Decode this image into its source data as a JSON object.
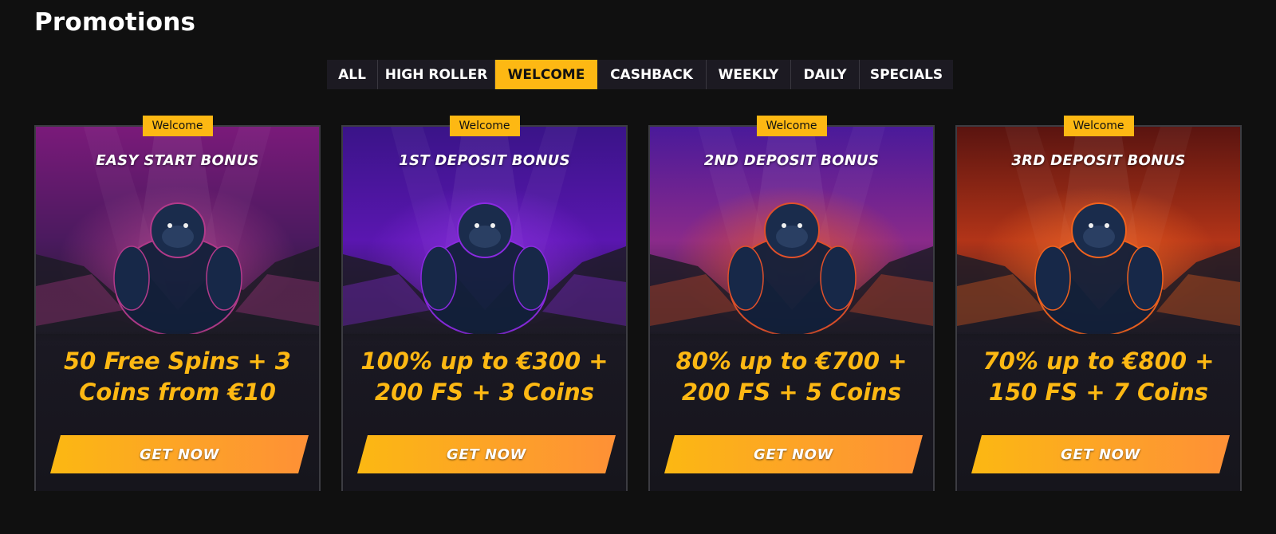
{
  "page": {
    "title": "Promotions"
  },
  "tabs": [
    {
      "label": "ALL",
      "active": false
    },
    {
      "label": "HIGH ROLLER",
      "active": false
    },
    {
      "label": "WELCOME",
      "active": true
    },
    {
      "label": "CASHBACK",
      "active": false
    },
    {
      "label": "WEEKLY",
      "active": false
    },
    {
      "label": "DAILY",
      "active": false
    },
    {
      "label": "SPECIALS",
      "active": false
    }
  ],
  "cards": [
    {
      "badge": "Welcome",
      "title": "EASY START BONUS",
      "offer_line1": "50 Free Spins + 3",
      "offer_line2": "Coins from €10",
      "cta": "GET NOW",
      "theme": {
        "top": "#7a1a7a",
        "mid": "#4a1a5e",
        "accent": "#b23a8a"
      }
    },
    {
      "badge": "Welcome",
      "title": "1ST DEPOSIT BONUS",
      "offer_line1": "100% up to €300 +",
      "offer_line2": "200 FS + 3 Coins",
      "cta": "GET NOW",
      "theme": {
        "top": "#3a1488",
        "mid": "#5a16b0",
        "accent": "#8a2ae0"
      }
    },
    {
      "badge": "Welcome",
      "title": "2ND DEPOSIT BONUS",
      "offer_line1": "80% up to €700 +",
      "offer_line2": "200 FS + 5 Coins",
      "cta": "GET NOW",
      "theme": {
        "top": "#4a1a9a",
        "mid": "#8a2a8a",
        "accent": "#e0502a"
      }
    },
    {
      "badge": "Welcome",
      "title": "3RD DEPOSIT BONUS",
      "offer_line1": "70% up to €800 +",
      "offer_line2": "150 FS + 7 Coins",
      "cta": "GET NOW",
      "theme": {
        "top": "#5a1410",
        "mid": "#b23418",
        "accent": "#f0621e"
      }
    }
  ],
  "colors": {
    "background": "#101010",
    "accent": "#fdb813",
    "card_border": "#3c3c42"
  },
  "icons": {
    "card_art": "gorilla-illustration"
  }
}
